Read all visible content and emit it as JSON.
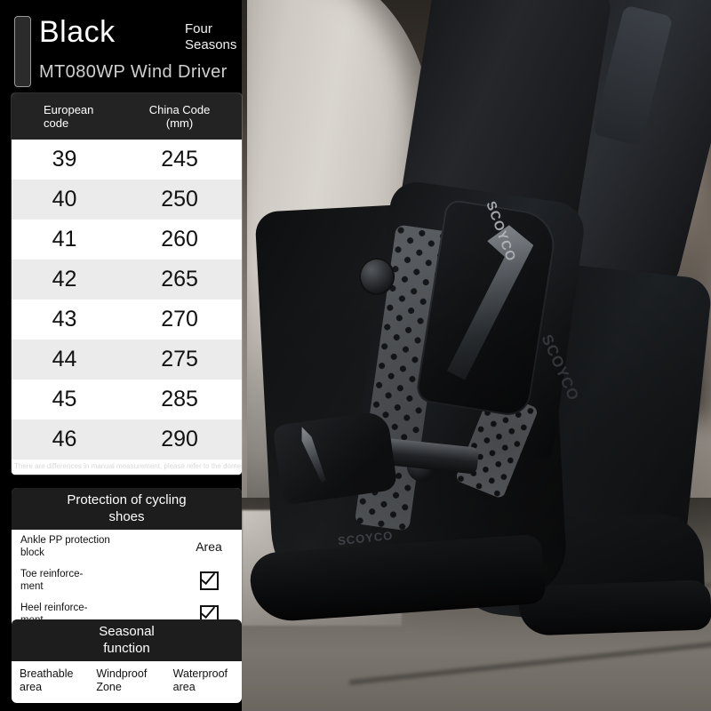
{
  "header": {
    "color_name": "Black",
    "corner_badge": "Four\nSeasons",
    "corner_badge_line1": "Four",
    "corner_badge_line2": "Seasons",
    "model": "MT080WP Wind Driver"
  },
  "size_table": {
    "columns": [
      {
        "label_line1": "European",
        "label_line2": "code"
      },
      {
        "label_line1": "China Code",
        "label_line2": "(mm)"
      }
    ],
    "european_header": "European code",
    "china_header": "China Code (mm)",
    "rows": [
      {
        "european": "39",
        "china": "245"
      },
      {
        "european": "40",
        "china": "250"
      },
      {
        "european": "41",
        "china": "260"
      },
      {
        "european": "42",
        "china": "265"
      },
      {
        "european": "43",
        "china": "270"
      },
      {
        "european": "44",
        "china": "275"
      },
      {
        "european": "45",
        "china": "285"
      },
      {
        "european": "46",
        "china": "290"
      }
    ],
    "note": "There are differences in manual measurement, please refer to the domestic"
  },
  "protection_panel": {
    "title_line1": "Protection of cycling",
    "title_line2": "shoes",
    "rows": [
      {
        "label_line1": "Ankle PP protection",
        "label_line2": "block",
        "value": "Area",
        "value_type": "text"
      },
      {
        "label_line1": "Toe reinforce-",
        "label_line2": "ment",
        "value": "☑",
        "value_type": "check"
      },
      {
        "label_line1": "Heel reinforce-",
        "label_line2": "ment",
        "value": "☑",
        "value_type": "check"
      }
    ]
  },
  "seasonal_panel": {
    "title_line1": "Seasonal",
    "title_line2": "function",
    "cells": [
      {
        "line1": "Breathable",
        "line2": "area"
      },
      {
        "line1": "Windproof",
        "line2": "Zone"
      },
      {
        "line1": "Waterproof",
        "line2": "area"
      }
    ]
  },
  "photo": {
    "product_brand": "SCOYCO",
    "description": "black motorcycle riding boots against concrete pillar"
  },
  "colors": {
    "background": "#000000",
    "panel_bg": "#ffffff",
    "panel_header_bg": "#1d1d1d",
    "table_header_bg": "#232323",
    "row_alt_bg": "#ebebeb",
    "title_text": "#ffffff",
    "subtitle_text": "#cfcfcf"
  }
}
